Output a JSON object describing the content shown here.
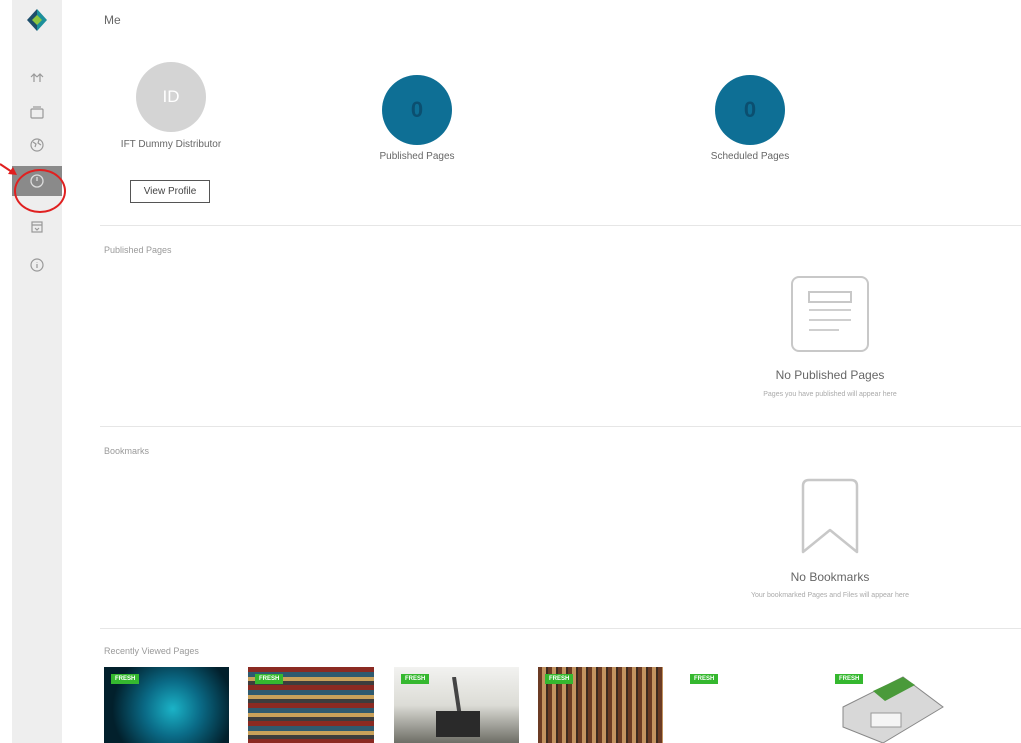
{
  "header": {
    "title": "Me"
  },
  "sidebar": {
    "items": [
      "home",
      "cards",
      "globe",
      "me",
      "calendar",
      "info"
    ],
    "active": "me"
  },
  "profile": {
    "initials": "ID",
    "name": "IFT Dummy Distributor",
    "view_profile_label": "View Profile"
  },
  "stats": {
    "published": {
      "value": "0",
      "label": "Published Pages"
    },
    "scheduled": {
      "value": "0",
      "label": "Scheduled Pages"
    }
  },
  "sections": {
    "published": {
      "title": "Published Pages",
      "empty_title": "No Published Pages",
      "empty_sub": "Pages you have published will appear here"
    },
    "bookmarks": {
      "title": "Bookmarks",
      "empty_title": "No Bookmarks",
      "empty_sub": "Your bookmarked Pages and Files will appear here"
    },
    "recent": {
      "title": "Recently Viewed Pages",
      "badge": "FRESH"
    }
  },
  "colors": {
    "accent": "#0e6f95",
    "badge": "#35b82f",
    "sidebar": "#eeeeee",
    "highlight": "#e02020"
  }
}
